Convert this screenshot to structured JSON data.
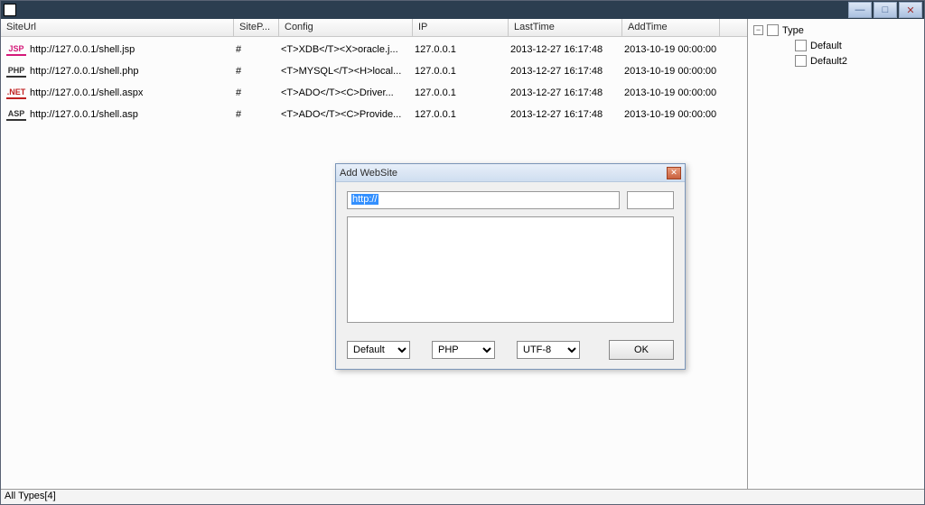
{
  "window": {
    "title": ""
  },
  "columns": {
    "url": "SiteUrl",
    "sitep": "SiteP...",
    "config": "Config",
    "ip": "IP",
    "last": "LastTime",
    "add": "AddTime"
  },
  "rows": [
    {
      "badge": "JSP",
      "badge_color": "#d41878",
      "url": "http://127.0.0.1/shell.jsp",
      "sitep": "#",
      "config": "<T>XDB</T><X>oracle.j...",
      "ip": "127.0.0.1",
      "last": "2013-12-27 16:17:48",
      "add": "2013-10-19 00:00:00"
    },
    {
      "badge": "PHP",
      "badge_color": "#333333",
      "url": "http://127.0.0.1/shell.php",
      "sitep": "#",
      "config": "<T>MYSQL</T><H>local...",
      "ip": "127.0.0.1",
      "last": "2013-12-27 16:17:48",
      "add": "2013-10-19 00:00:00"
    },
    {
      "badge": ".NET",
      "badge_color": "#c02020",
      "url": "http://127.0.0.1/shell.aspx",
      "sitep": "#",
      "config": "<T>ADO</T><C>Driver...",
      "ip": "127.0.0.1",
      "last": "2013-12-27 16:17:48",
      "add": "2013-10-19 00:00:00"
    },
    {
      "badge": "ASP",
      "badge_color": "#333333",
      "url": "http://127.0.0.1/shell.asp",
      "sitep": "#",
      "config": "<T>ADO</T><C>Provide...",
      "ip": "127.0.0.1",
      "last": "2013-12-27 16:17:48",
      "add": "2013-10-19 00:00:00"
    }
  ],
  "tree": {
    "root": "Type",
    "children": [
      "Default",
      "Default2"
    ]
  },
  "status": "All Types[4]",
  "dialog": {
    "title": "Add WebSite",
    "url_value": "http://",
    "select_type": {
      "options": [
        "Default"
      ],
      "value": "Default"
    },
    "select_lang": {
      "options": [
        "PHP"
      ],
      "value": "PHP"
    },
    "select_enc": {
      "options": [
        "UTF-8"
      ],
      "value": "UTF-8"
    },
    "ok": "OK"
  }
}
